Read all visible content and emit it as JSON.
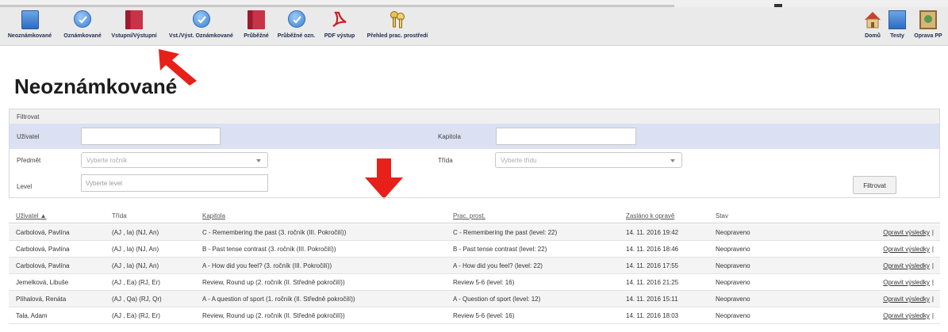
{
  "toolbar": {
    "items": [
      {
        "label": "Neoznámkované",
        "icon": "blue-book-icon"
      },
      {
        "label": "Oznámkované",
        "icon": "blue-check-icon"
      },
      {
        "label": "Vstupní/Výstupní",
        "icon": "red-book-icon"
      },
      {
        "label": "Vst./Výst. Oznámkované",
        "icon": "blue-check-icon"
      },
      {
        "label": "Průběžné",
        "icon": "red-book-icon"
      },
      {
        "label": "Průběžné ozn.",
        "icon": "blue-check-icon"
      },
      {
        "label": "PDF výstup",
        "icon": "pdf-icon"
      },
      {
        "label": "Přehled prac. prostředí",
        "icon": "keys-icon"
      }
    ],
    "right_items": [
      {
        "label": "Domů",
        "icon": "home-icon"
      },
      {
        "label": "Testy",
        "icon": "tests-icon"
      },
      {
        "label": "Oprava PP",
        "icon": "picture-icon"
      }
    ]
  },
  "page": {
    "title": "Neoznámkované"
  },
  "filter": {
    "heading": "Filtrovat",
    "user_label": "Uživatel",
    "user_value": "",
    "chapter_label": "Kapitola",
    "chapter_value": "",
    "subject_label": "Předmět",
    "subject_placeholder": "Vyberte ročník",
    "class_label": "Třída",
    "class_placeholder": "Vyberte třídu",
    "level_label": "Level",
    "level_placeholder": "Vyberte level",
    "button_label": "Filtrovat"
  },
  "table": {
    "headers": {
      "user": "Uživatel ▲",
      "class": "Třída",
      "chapter": "Kapitola",
      "workspace": "Prac. prost.",
      "sent": "Zasláno k opravě",
      "state": "Stav"
    },
    "action_label": "Opravit výsledky",
    "action_sep": "|",
    "rows": [
      {
        "user": "Carbolová, Pavlína",
        "class": "(AJ , Ia) (NJ, An)",
        "chapter": "C - Remembering the past (3. ročník (III. Pokročilí))",
        "workspace": "C - Remembering the past (level: 22)",
        "sent": "14. 11. 2016 19:42",
        "state": "Neopraveno"
      },
      {
        "user": "Carbolová, Pavlína",
        "class": "(AJ , Ia) (NJ, An)",
        "chapter": "B - Past tense contrast (3. ročník (III. Pokročilí))",
        "workspace": "B - Past tense contrast (level: 22)",
        "sent": "14. 11. 2016 18:46",
        "state": "Neopraveno"
      },
      {
        "user": "Carbolová, Pavlína",
        "class": "(AJ , Ia) (NJ, An)",
        "chapter": "A - How did you feel? (3. ročník (III. Pokročilí))",
        "workspace": "A - How did you feel? (level: 22)",
        "sent": "14. 11. 2016 17:55",
        "state": "Neopraveno"
      },
      {
        "user": "Jemelková, Libuše",
        "class": "(AJ , Ea) (RJ, Er)",
        "chapter": "Review, Round up (2. ročník (II. Středně pokročilí))",
        "workspace": "Review 5-6 (level: 16)",
        "sent": "14. 11. 2016 21:25",
        "state": "Neopraveno"
      },
      {
        "user": "Plíhalová, Renáta",
        "class": "(AJ , Qa) (RJ, Qr)",
        "chapter": "A - A question of sport (1. ročník (II. Středně pokročilí))",
        "workspace": "A - Question of sport (level: 12)",
        "sent": "14. 11. 2016 15:11",
        "state": "Neopraveno"
      },
      {
        "user": "Tala, Adam",
        "class": "(AJ , Ea) (RJ, Er)",
        "chapter": "Review, Round up (2. ročník (II. Středně pokročilí))",
        "workspace": "Review 5-6 (level: 16)",
        "sent": "14. 11. 2016 18:03",
        "state": "Neopraveno"
      }
    ]
  },
  "colors": {
    "accent_arrow": "#e8201a",
    "filter_row": "#dbe1f3",
    "toolbar_text": "#1c2a52"
  }
}
